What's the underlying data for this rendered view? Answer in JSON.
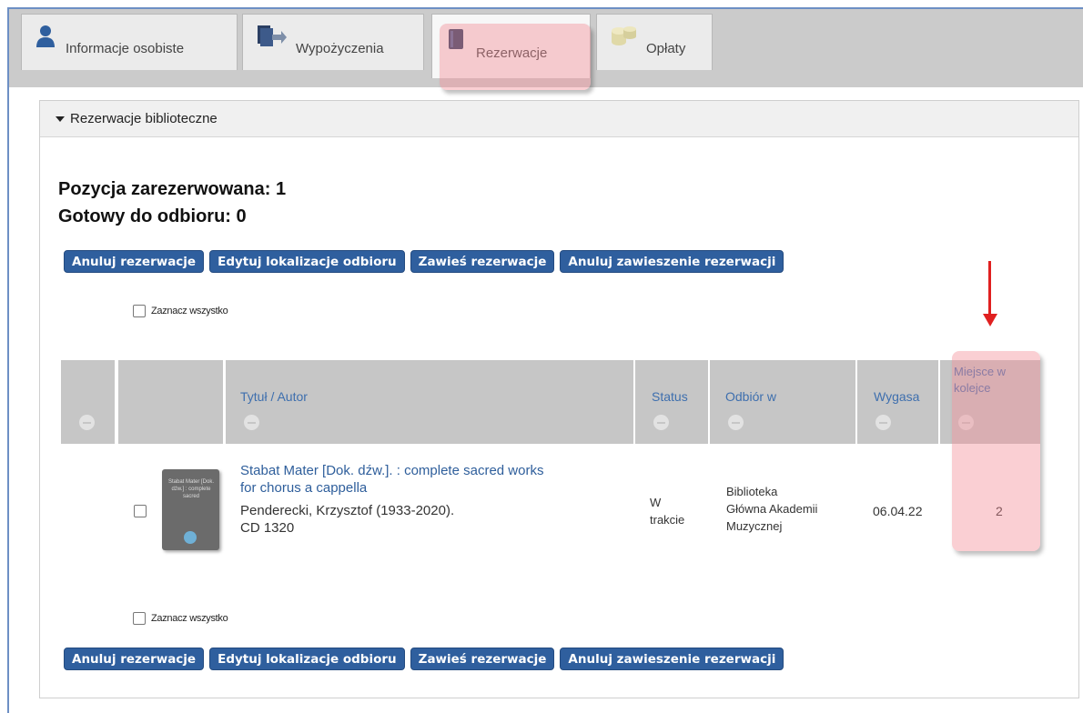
{
  "tabs": [
    {
      "label": "Informacje osobiste",
      "icon": "person-icon"
    },
    {
      "label": "Wypożyczenia",
      "icon": "books-arrow-icon"
    },
    {
      "label": "Rezerwacje",
      "icon": "book-icon",
      "active": true
    },
    {
      "label": "Opłaty",
      "icon": "coins-icon"
    }
  ],
  "panel": {
    "title": "Rezerwacje biblioteczne",
    "summary_reserved": "Pozycja zarezerwowana: 1",
    "summary_ready": "Gotowy do odbioru: 0"
  },
  "actions": {
    "cancel": "Anuluj rezerwacje",
    "edit_location": "Edytuj lokalizacje odbioru",
    "suspend": "Zawieś rezerwacje",
    "cancel_suspend": "Anuluj zawieszenie rezerwacji"
  },
  "select_all": "Zaznacz wszystko",
  "table": {
    "headers": {
      "title": "Tytuł / Autor",
      "status": "Status",
      "pickup": "Odbiór w",
      "expires": "Wygasa",
      "queue_line1": "Miejsce w",
      "queue_line2": "kolejce"
    },
    "rows": [
      {
        "cover_text": "Stabat Mater [Dok. dźw.] : complete sacred",
        "title_line1": "Stabat Mater [Dok. dźw.]. : complete sacred works",
        "title_line2": "for chorus a cappella",
        "author": "Penderecki, Krzysztof (1933-2020).",
        "callno": "CD 1320",
        "status_line1": "W",
        "status_line2": "trakcie",
        "pickup_line1": "Biblioteka",
        "pickup_line2": "Główna Akademii",
        "pickup_line3": "Muzycznej",
        "expires": "06.04.22",
        "queue": "2"
      }
    ]
  },
  "colors": {
    "button": "#2f5f9e",
    "header_bg": "#c6c6c6",
    "link": "#2e5e9b",
    "highlight": "#f28c96",
    "arrow": "#e02020"
  }
}
